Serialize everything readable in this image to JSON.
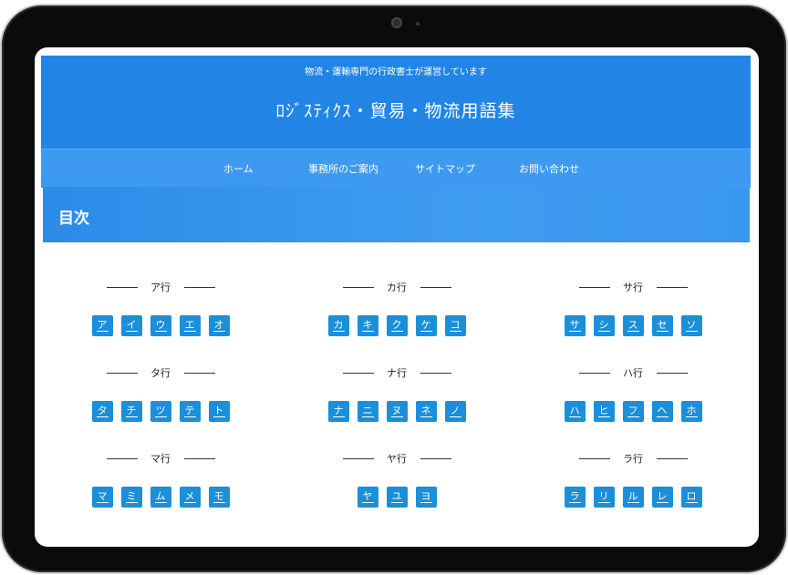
{
  "header": {
    "tagline": "物流・運輸専門の行政書士が運営しています",
    "site_title": "ﾛｼﾞｽﾃｨｸｽ・貿易・物流用語集"
  },
  "nav": {
    "items": [
      "ホーム",
      "事務所のご案内",
      "サイトマップ",
      "お問い合わせ"
    ]
  },
  "toc": {
    "title": "目次"
  },
  "groups": [
    {
      "label": "ア行",
      "keys": [
        "ア",
        "イ",
        "ウ",
        "エ",
        "オ"
      ]
    },
    {
      "label": "カ行",
      "keys": [
        "カ",
        "キ",
        "ク",
        "ケ",
        "コ"
      ]
    },
    {
      "label": "サ行",
      "keys": [
        "サ",
        "シ",
        "ス",
        "セ",
        "ソ"
      ]
    },
    {
      "label": "タ行",
      "keys": [
        "タ",
        "チ",
        "ツ",
        "テ",
        "ト"
      ]
    },
    {
      "label": "ナ行",
      "keys": [
        "ナ",
        "ニ",
        "ヌ",
        "ネ",
        "ノ"
      ]
    },
    {
      "label": "ハ行",
      "keys": [
        "ハ",
        "ヒ",
        "フ",
        "ヘ",
        "ホ"
      ]
    },
    {
      "label": "マ行",
      "keys": [
        "マ",
        "ミ",
        "ム",
        "メ",
        "モ"
      ]
    },
    {
      "label": "ヤ行",
      "keys": [
        "ヤ",
        "ユ",
        "ヨ"
      ]
    },
    {
      "label": "ラ行",
      "keys": [
        "ラ",
        "リ",
        "ル",
        "レ",
        "ロ"
      ]
    }
  ],
  "colors": {
    "header_bg": "#2285e6",
    "nav_bg": "#3d9af0",
    "key_bg": "#1b8fd9",
    "device_frame": "#0b0b0b"
  }
}
